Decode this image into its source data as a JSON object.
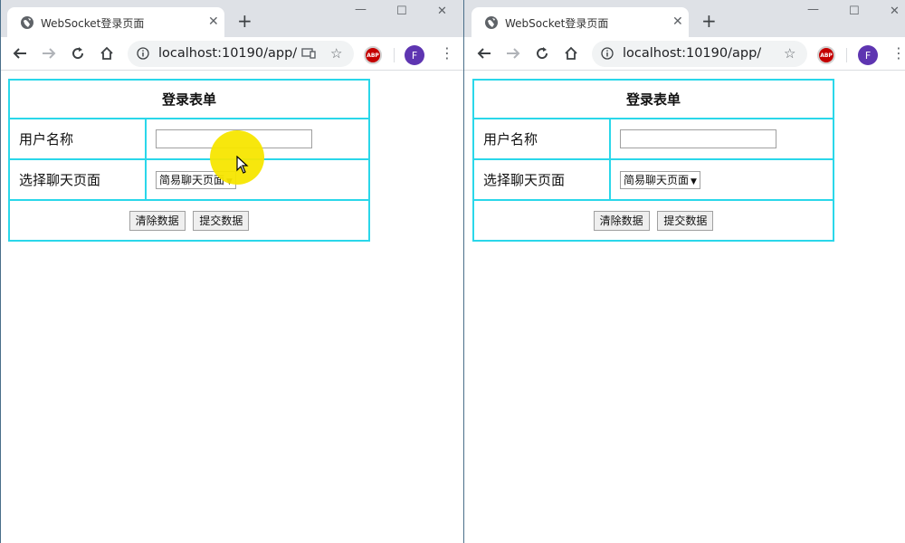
{
  "browser": {
    "tab_title": "WebSocket登录页面",
    "url": "localhost:10190/app/",
    "profile_initial": "F",
    "adblock_label": "ABP"
  },
  "form": {
    "title": "登录表单",
    "username_label": "用户名称",
    "username_value": "",
    "chat_label": "选择聊天页面",
    "chat_selected": "简易聊天页面",
    "clear_button": "清除数据",
    "submit_button": "提交数据"
  },
  "colors": {
    "table_border": "#2ad7ea",
    "cursor_highlight": "#f7e600",
    "profile": "#5e35b1"
  },
  "icons": [
    "globe-icon",
    "close-icon",
    "plus-icon",
    "back-arrow-icon",
    "forward-arrow-icon",
    "reload-icon",
    "home-icon",
    "info-icon",
    "cast-icon",
    "star-icon",
    "adblock-icon",
    "kebab-menu-icon",
    "minimize-icon",
    "maximize-icon",
    "window-close-icon",
    "mouse-cursor-icon"
  ]
}
